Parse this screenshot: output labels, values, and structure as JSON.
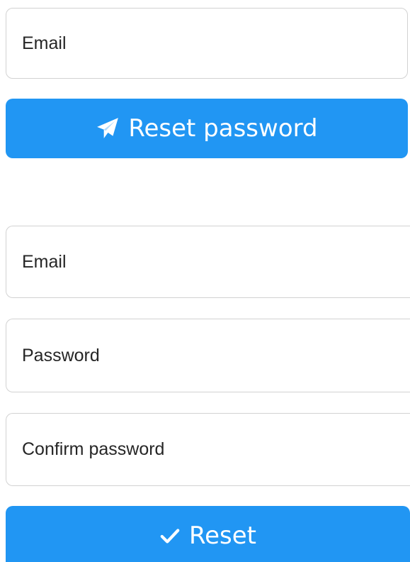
{
  "request_form": {
    "email_placeholder": "Email",
    "submit_label": "Reset password",
    "submit_icon": "paper-plane-icon"
  },
  "reset_form": {
    "email_placeholder": "Email",
    "password_placeholder": "Password",
    "confirm_password_placeholder": "Confirm password",
    "submit_label": "Reset",
    "submit_icon": "check-icon"
  },
  "colors": {
    "primary": "#2196f3",
    "text": "#262626",
    "border": "#d2d2d2"
  }
}
